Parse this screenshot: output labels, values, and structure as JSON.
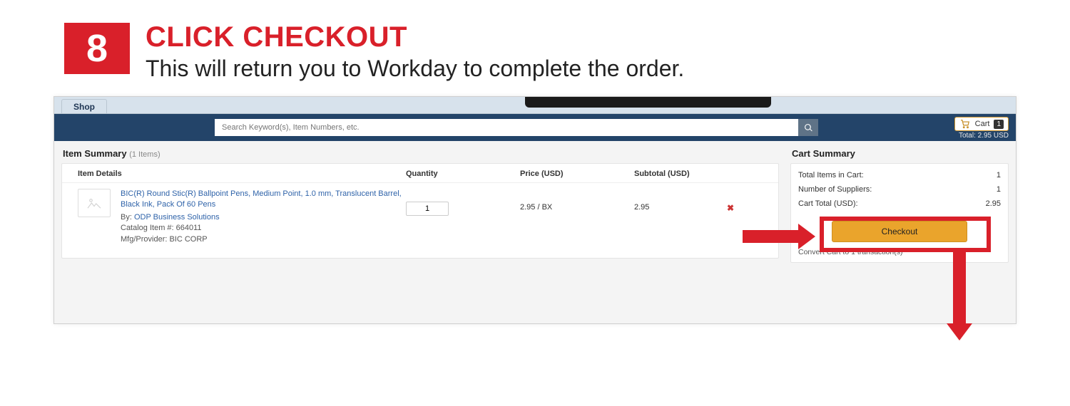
{
  "step": {
    "number": "8",
    "title": "CLICK CHECKOUT",
    "subtitle": "This will return you to Workday to complete the order."
  },
  "tabs": {
    "active": "Shop"
  },
  "search": {
    "placeholder": "Search Keyword(s), Item Numbers, etc."
  },
  "cart_indicator": {
    "label": "Cart",
    "count": "1",
    "total_label": "Total: 2.95 USD"
  },
  "item_summary": {
    "title": "Item Summary",
    "count_text": "(1 Items)",
    "headers": {
      "details": "Item Details",
      "qty": "Quantity",
      "price": "Price (USD)",
      "subtotal": "Subtotal (USD)"
    },
    "item": {
      "name": "BIC(R) Round Stic(R) Ballpoint Pens, Medium Point, 1.0 mm, Translucent Barrel, Black Ink, Pack Of 60 Pens",
      "by_prefix": "By: ",
      "supplier": "ODP Business Solutions",
      "catalog": "Catalog Item #: 664011",
      "mfg": "Mfg/Provider: BIC CORP",
      "qty": "1",
      "price": "2.95 / BX",
      "subtotal": "2.95"
    }
  },
  "cart_summary": {
    "title": "Cart Summary",
    "rows": {
      "items_label": "Total Items in Cart:",
      "items_value": "1",
      "suppliers_label": "Number of Suppliers:",
      "suppliers_value": "1",
      "total_label": "Cart Total (USD):",
      "total_value": "2.95"
    },
    "checkout_label": "Checkout",
    "convert_note": "Convert Cart to 1 transaction(s)"
  }
}
